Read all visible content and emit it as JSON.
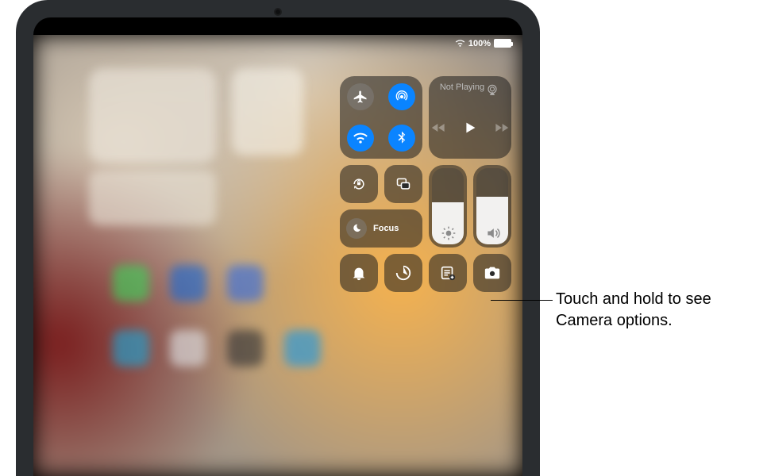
{
  "status": {
    "battery_pct": "100%"
  },
  "connectivity": {
    "airplane": {
      "on": false
    },
    "airdrop": {
      "on": true
    },
    "wifi": {
      "on": true
    },
    "bluetooth": {
      "on": true
    }
  },
  "media": {
    "now_playing": "Not Playing"
  },
  "focus": {
    "label": "Focus"
  },
  "brightness_pct": 55,
  "volume_pct": 62,
  "callout": "Touch and hold to see Camera options."
}
